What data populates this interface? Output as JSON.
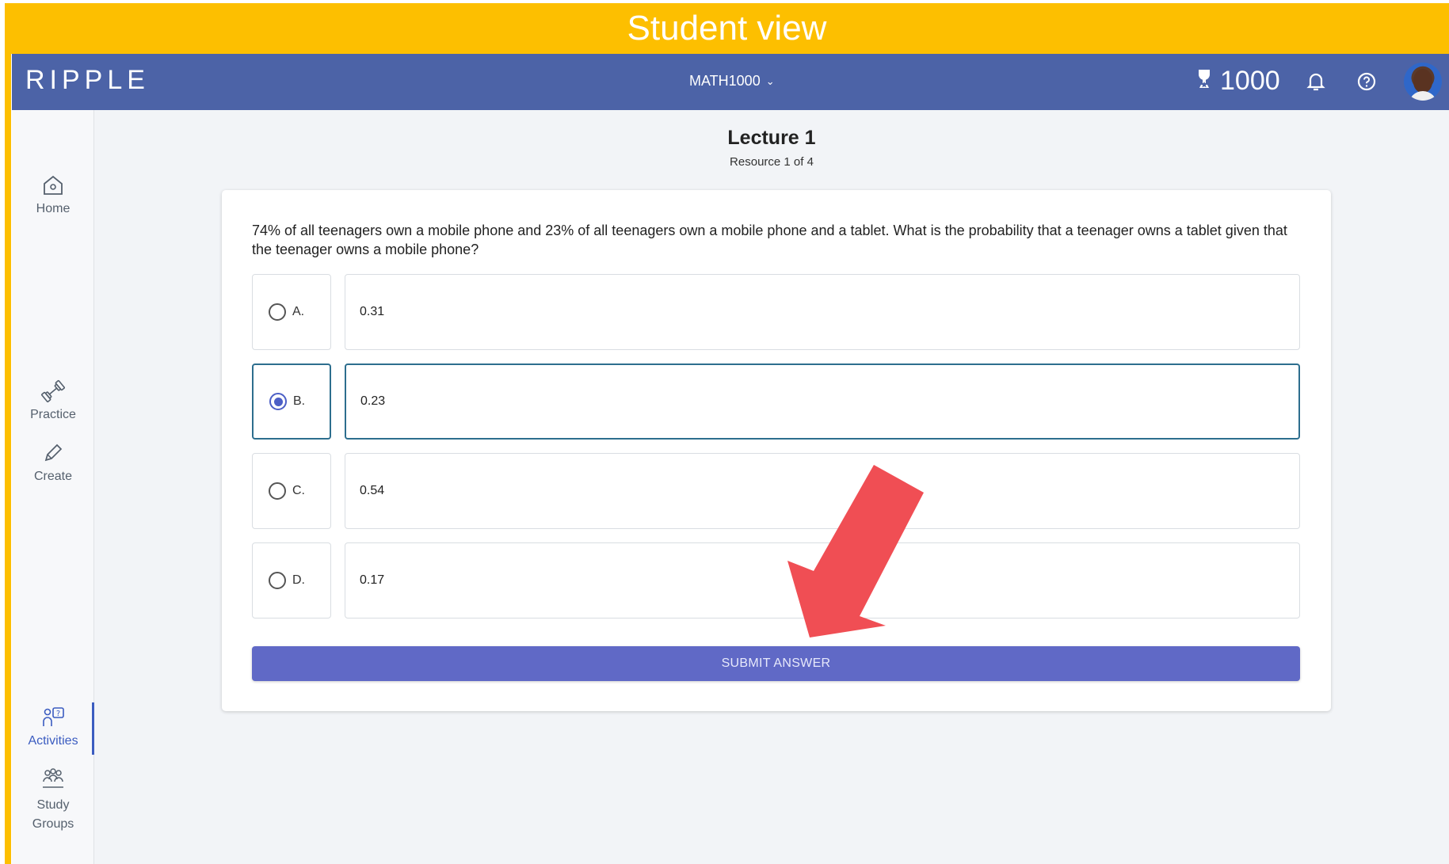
{
  "banner": {
    "label": "Student view"
  },
  "header": {
    "logo": "RIPPLE",
    "course": "MATH1000",
    "points": "1000"
  },
  "sidebar": {
    "items": [
      {
        "label": "Home",
        "icon": "home-icon"
      },
      {
        "label": "Practice",
        "icon": "dumbbell-icon"
      },
      {
        "label": "Create",
        "icon": "pencil-icon"
      },
      {
        "label": "Activities",
        "icon": "activities-icon",
        "active": true
      },
      {
        "label": "Study",
        "label2": "Groups",
        "icon": "study-groups-icon"
      }
    ]
  },
  "main": {
    "title": "Lecture 1",
    "subtitle": "Resource 1 of 4",
    "question": "74% of all teenagers own a mobile phone and 23% of all teenagers own a mobile phone and a tablet. What is the probability that a teenager owns a tablet given that the teenager owns a mobile phone?",
    "options": [
      {
        "letter": "A.",
        "value": "0.31",
        "selected": false
      },
      {
        "letter": "B.",
        "value": "0.23",
        "selected": true
      },
      {
        "letter": "C.",
        "value": "0.54",
        "selected": false
      },
      {
        "letter": "D.",
        "value": "0.17",
        "selected": false
      }
    ],
    "submit_label": "SUBMIT ANSWER"
  },
  "colors": {
    "banner": "#fdbf00",
    "topbar": "#4c63a7",
    "submit": "#6069c6",
    "arrow": "#f04e54",
    "selected_border": "#2d6e8e"
  }
}
